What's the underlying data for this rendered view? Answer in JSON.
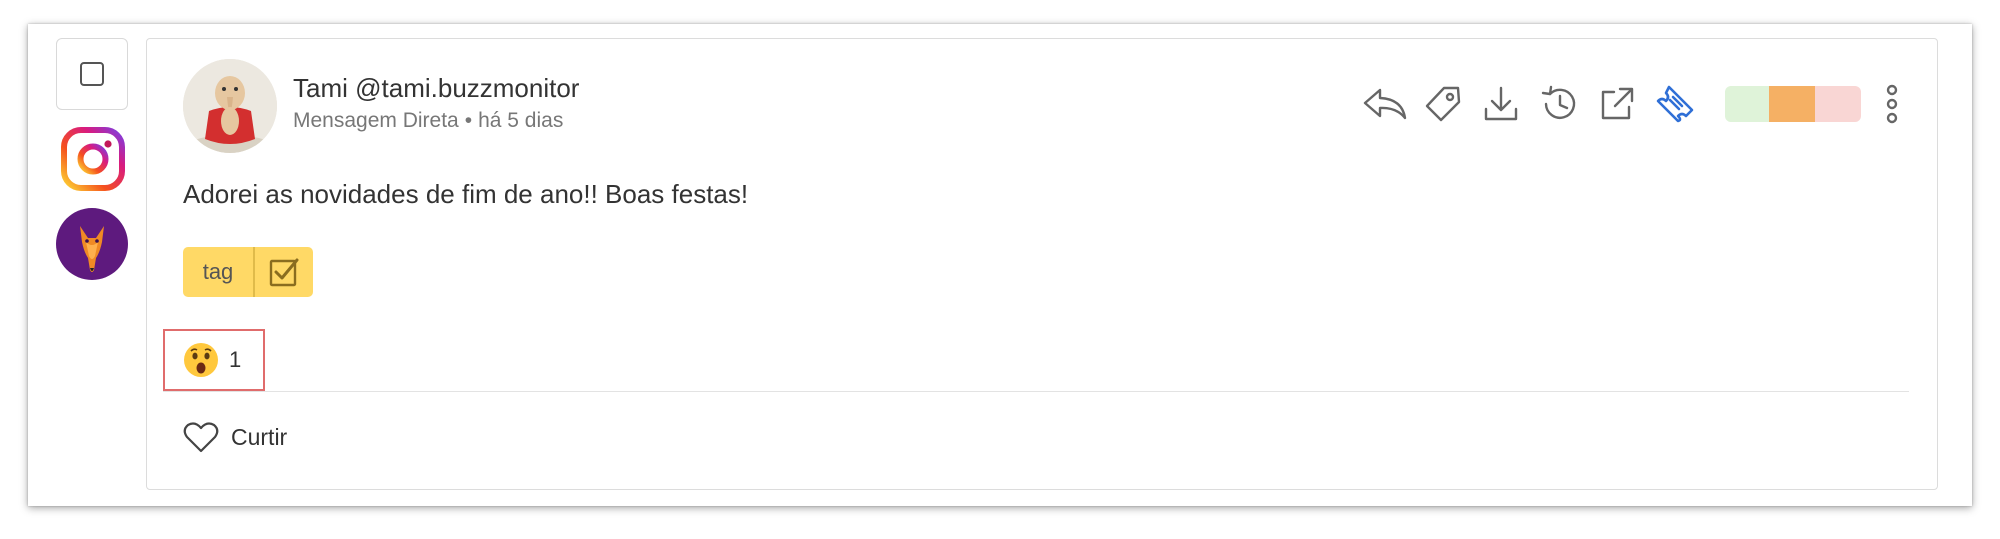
{
  "post": {
    "author": "Tami @tami.buzzmonitor",
    "channel": "Mensagem Direta",
    "separator": "•",
    "time_ago": "há 5 dias",
    "text": "Adorei as novidades de fim de ano!! Boas festas!",
    "network_icon": "instagram-icon",
    "brand_avatar_icon": "buzzmonitor-mascot-icon"
  },
  "toolbar": {
    "icons": [
      "reply-icon",
      "tag-icon",
      "download-icon",
      "history-icon",
      "external-link-icon",
      "ticket-icon"
    ],
    "accent_color": "#2f6fd6"
  },
  "sentiment": {
    "colors": {
      "positive": "#dff3d9",
      "neutral": "#f5b064",
      "negative": "#f9d6d4"
    }
  },
  "tag": {
    "label": "tag",
    "color": "#ffd966"
  },
  "reactions": [
    {
      "emoji": "😮",
      "icon": "surprised-face-icon",
      "count": "1"
    }
  ],
  "actions": {
    "like_label": "Curtir"
  }
}
